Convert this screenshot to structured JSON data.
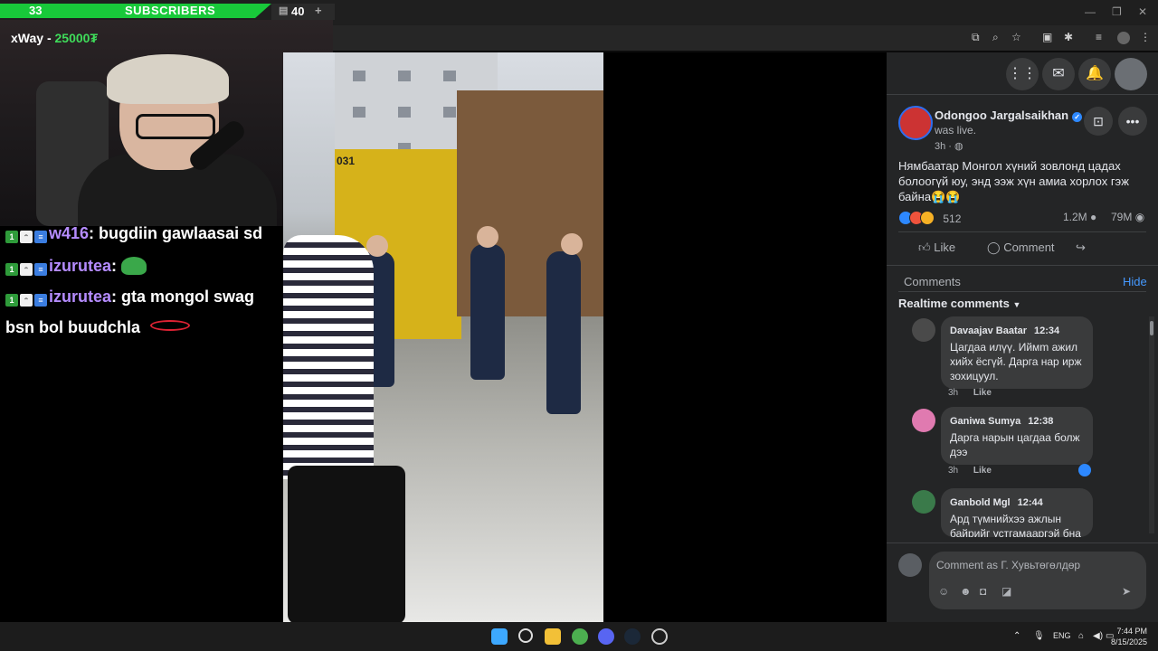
{
  "stream": {
    "sub_count": "33",
    "sub_label": "SUBSCRIBERS",
    "sub_goal": "40",
    "donor_name": "xWay",
    "donor_amount": "25000₮"
  },
  "chat": [
    {
      "user": "w416",
      "message": "bugdiin gawlaasai sd"
    },
    {
      "user": "izurutea",
      "message": ""
    },
    {
      "user": "izurutea",
      "message": "gta mongol swag"
    },
    {
      "continuation": "bsn bol buudchla"
    }
  ],
  "video": {
    "truck_number": "031"
  },
  "facebook": {
    "post": {
      "author": "Odongoo Jargalsaikhan",
      "status": "was live.",
      "time": "3h",
      "text": "Нямбаатар Монгол хүний зовлонд цадах болоогүй юу, энд ээж хүн амиа хорлох гэж байна😭😭",
      "reactions": "512",
      "comments_count": "1.2M",
      "views": "79M"
    },
    "actions": {
      "like": "Like",
      "comment": "Comment"
    },
    "comments_header": "Comments",
    "hide": "Hide",
    "sort_label": "Realtime comments",
    "comments": [
      {
        "name": "Davaajav Baatar",
        "time": "12:34",
        "text": "Цагдаа илүү. Иймm ажил хийх ёсгүй. Дарга нар ирж зохицуул.",
        "age": "3h",
        "like": "Like"
      },
      {
        "name": "Ganiwa Sumya",
        "time": "12:38",
        "text": "Дарга нарын цагдаа болж дээ",
        "age": "3h",
        "like": "Like"
      },
      {
        "name": "Ganbold Mgl",
        "time": "12:44",
        "text": "Ард түмнийхээ ажлын байрийг устгамааргэй бна"
      }
    ],
    "composer_placeholder": "Comment as Г. Хувьтөгөлдөр"
  },
  "taskbar": {
    "lang": "ENG",
    "time": "7:44 PM",
    "date": "8/15/2025"
  },
  "colors": {
    "sub_bar": "#18c93a",
    "fb_bg": "#242526",
    "fb_link": "#4599ff",
    "chat_user": "#b58cff"
  }
}
